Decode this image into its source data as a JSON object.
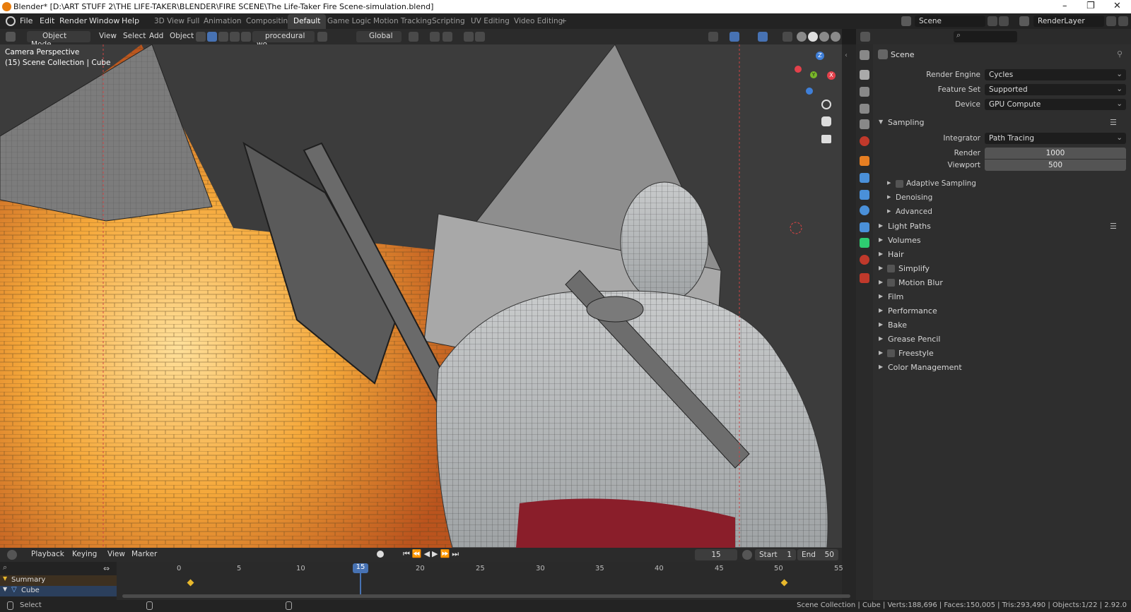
{
  "titlebar": {
    "title": "Blender* [D:\\ART STUFF 2\\THE LIFE-TAKER\\BLENDER\\FIRE SCENE\\The Life-Taker Fire Scene-simulation.blend]",
    "minimize": "–",
    "restore": "❐",
    "close": "✕"
  },
  "menu": [
    "File",
    "Edit",
    "Render",
    "Window",
    "Help"
  ],
  "workspaces": [
    {
      "label": "3D View Full",
      "active": false
    },
    {
      "label": "Animation",
      "active": false
    },
    {
      "label": "Compositing",
      "active": false
    },
    {
      "label": "Default",
      "active": true
    },
    {
      "label": "Game Logic",
      "active": false
    },
    {
      "label": "Motion Tracking",
      "active": false
    },
    {
      "label": "Scripting",
      "active": false
    },
    {
      "label": "UV Editing",
      "active": false
    },
    {
      "label": "Video Editing",
      "active": false
    }
  ],
  "add_workspace": "+",
  "scene_field": "Scene",
  "renderlayer_field": "RenderLayer",
  "viewport_header": {
    "mode": "Object Mode",
    "view": "View",
    "select": "Select",
    "add": "Add",
    "object": "Object",
    "material_search": "procedural wo...",
    "orientation": "Global"
  },
  "viewport_overlay": {
    "camera": "Camera Perspective",
    "collection": "(15) Scene Collection | Cube"
  },
  "gizmo": {
    "z": "Z",
    "y": "Y",
    "x": "X"
  },
  "properties": {
    "context": "Scene",
    "render_engine_label": "Render Engine",
    "render_engine": "Cycles",
    "feature_set_label": "Feature Set",
    "feature_set": "Supported",
    "device_label": "Device",
    "device": "GPU Compute",
    "sampling": "Sampling",
    "integrator_label": "Integrator",
    "integrator": "Path Tracing",
    "render_label": "Render",
    "render_samples": "1000",
    "viewport_label": "Viewport",
    "viewport_samples": "500",
    "subpanels": [
      {
        "label": "Adaptive Sampling",
        "checkbox": true
      },
      {
        "label": "Denoising",
        "checkbox": false
      },
      {
        "label": "Advanced",
        "checkbox": false
      }
    ],
    "panels": [
      {
        "label": "Light Paths",
        "checkbox": false
      },
      {
        "label": "Volumes",
        "checkbox": false
      },
      {
        "label": "Hair",
        "checkbox": false
      },
      {
        "label": "Simplify",
        "checkbox": true
      },
      {
        "label": "Motion Blur",
        "checkbox": true
      },
      {
        "label": "Film",
        "checkbox": false
      },
      {
        "label": "Performance",
        "checkbox": false
      },
      {
        "label": "Bake",
        "checkbox": false
      },
      {
        "label": "Grease Pencil",
        "checkbox": false
      },
      {
        "label": "Freestyle",
        "checkbox": true
      },
      {
        "label": "Color Management",
        "checkbox": false
      }
    ]
  },
  "timeline": {
    "playback": "Playback",
    "keying": "Keying",
    "view": "View",
    "marker": "Marker",
    "current_frame": "15",
    "start_label": "Start",
    "start": "1",
    "end_label": "End",
    "end": "50",
    "ticks": [
      "0",
      "5",
      "10",
      "15",
      "20",
      "25",
      "30",
      "35",
      "40",
      "45",
      "50",
      "55"
    ],
    "tracks": [
      "Summary",
      "Cube"
    ]
  },
  "status": {
    "select": "Select",
    "info": "Scene Collection | Cube | Verts:188,696 | Faces:150,005 | Tris:293,490 | Objects:1/22 | 2.92.0"
  },
  "colors": {
    "accent_blue": "#4772b3",
    "fire_orange": "#f0a030",
    "pants_red": "#8a1e2a",
    "keyframe": "#e8b82c"
  }
}
